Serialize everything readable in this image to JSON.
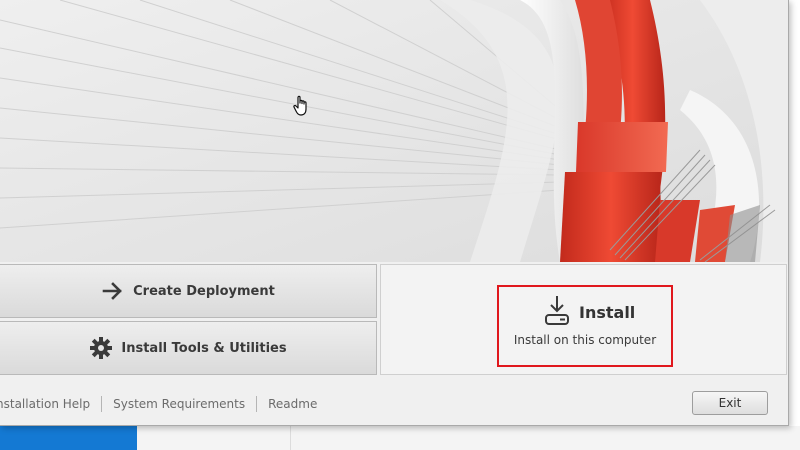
{
  "hero": {
    "image": "autocad-red-ribbon-artwork",
    "accent_color": "#e03c2a"
  },
  "actions": {
    "create_deployment_label": "Create Deployment",
    "create_deployment_icon": "arrow-right-icon",
    "install_tools_label": "Install Tools & Utilities",
    "install_tools_icon": "gear-icon"
  },
  "install": {
    "title": "Install",
    "subtitle": "Install on this computer",
    "icon": "download-icon",
    "highlight_color": "#e0171c"
  },
  "footer": {
    "links": [
      "nstallation Help",
      "System Requirements",
      "Readme"
    ],
    "exit_label": "Exit"
  },
  "cursor": {
    "icon": "hand-pointer-icon"
  }
}
